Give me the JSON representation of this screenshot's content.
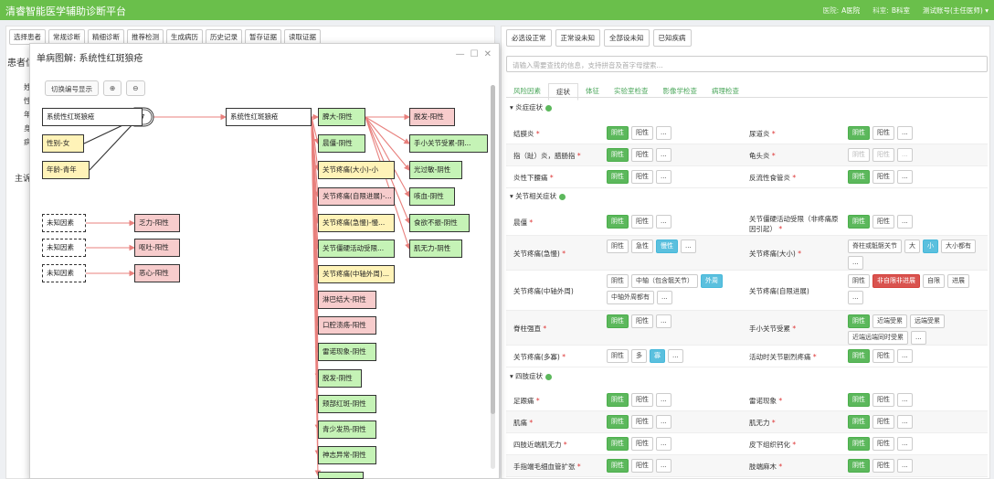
{
  "app": {
    "title": "清睿智能医学辅助诊断平台",
    "hospital_label": "医院:",
    "hospital": "A医院",
    "dept_label": "科室:",
    "dept": "B科室",
    "account": "测试账号(主任医师)",
    "account_caret": "▾"
  },
  "left": {
    "nav": [
      "选择患者",
      "常规诊断",
      "精细诊断",
      "推荐检测",
      "生成病历",
      "历史记录",
      "暂存证据",
      "读取证据"
    ],
    "label_patient": "患者信",
    "label_main": "主诉",
    "side_chars": [
      "姓",
      "性",
      "年",
      "身",
      "病"
    ]
  },
  "modal": {
    "title": "单病图解: 系统性红斑狼疮",
    "minimize": "—",
    "maximize": "☐",
    "close": "✕",
    "toggle_label": "切换编号显示",
    "zoom_in": "⊕",
    "zoom_out": "⊖",
    "gate_number": "7",
    "nodes": [
      {
        "id": "src",
        "text": "系统性红斑狼疮",
        "style": "white"
      },
      {
        "id": "sex",
        "text": "性别-女",
        "style": "yellow"
      },
      {
        "id": "age",
        "text": "年龄-青年",
        "style": "yellow"
      },
      {
        "id": "dis",
        "text": "系统性红斑狼疮",
        "style": "white"
      },
      {
        "id": "u1",
        "text": "未知因素",
        "style": "dashed"
      },
      {
        "id": "u2",
        "text": "未知因素",
        "style": "dashed"
      },
      {
        "id": "u3",
        "text": "未知因素",
        "style": "dashed"
      },
      {
        "id": "e1",
        "text": "乏力-阳性",
        "style": "pink"
      },
      {
        "id": "e2",
        "text": "呕吐-阳性",
        "style": "pink"
      },
      {
        "id": "e3",
        "text": "恶心-阳性",
        "style": "pink"
      },
      {
        "id": "c1",
        "text": "脾大-阴性",
        "style": "green"
      },
      {
        "id": "c2",
        "text": "晨僵-阴性",
        "style": "green"
      },
      {
        "id": "c3",
        "text": "关节疼痛(大小)-小",
        "style": "yellow"
      },
      {
        "id": "c4",
        "text": "关节疼痛(自限进展)-...",
        "style": "pink"
      },
      {
        "id": "c5",
        "text": "关节疼痛(急慢)-慢...",
        "style": "yellow"
      },
      {
        "id": "c6",
        "text": "关节僵硬活动受限...",
        "style": "green"
      },
      {
        "id": "c7",
        "text": "关节疼痛(中轴外周)...",
        "style": "yellow"
      },
      {
        "id": "c8",
        "text": "淋巴结大-阳性",
        "style": "pink"
      },
      {
        "id": "c9",
        "text": "口腔溃疡-阳性",
        "style": "pink"
      },
      {
        "id": "c10",
        "text": "雷诺现象-阴性",
        "style": "green"
      },
      {
        "id": "c11",
        "text": "脱发-阴性",
        "style": "green"
      },
      {
        "id": "c12",
        "text": "颊部红斑-阴性",
        "style": "green"
      },
      {
        "id": "c13",
        "text": "青少发热-阴性",
        "style": "green"
      },
      {
        "id": "c14",
        "text": "神志异常-阴性",
        "style": "green"
      },
      {
        "id": "c15",
        "text": "",
        "style": "green"
      },
      {
        "id": "d1",
        "text": "脱发-阳性",
        "style": "pink"
      },
      {
        "id": "d2",
        "text": "手小关节受累-阴...",
        "style": "green"
      },
      {
        "id": "d3",
        "text": "光过敏-阴性",
        "style": "green"
      },
      {
        "id": "d4",
        "text": "咳血-阴性",
        "style": "green"
      },
      {
        "id": "d5",
        "text": "食欲不振-阴性",
        "style": "green"
      },
      {
        "id": "d6",
        "text": "肌无力-阴性",
        "style": "green"
      }
    ]
  },
  "right": {
    "top_buttons": [
      "必选设正常",
      "正常设未知",
      "全部设未知",
      "已知疾病"
    ],
    "search_placeholder": "请输入需要查找的信息，支持拼音及首字母搜索...",
    "tabs": [
      "风险因素",
      "症状",
      "体征",
      "实验室检查",
      "影像学检查",
      "病理检查"
    ],
    "active_tab": 1,
    "sections": [
      "炎症症状",
      "关节相关症状",
      "四肢症状"
    ],
    "section_caret": "▾",
    "rows": [
      {
        "left": {
          "label": "结膜炎",
          "req": true,
          "opts": [
            {
              "t": "阴性",
              "s": "g"
            },
            {
              "t": "阳性"
            },
            {
              "t": "..."
            }
          ]
        },
        "right": {
          "label": "尿道炎",
          "req": true,
          "opts": [
            {
              "t": "阴性",
              "s": "g"
            },
            {
              "t": "阳性"
            },
            {
              "t": "..."
            }
          ]
        }
      },
      {
        "left": {
          "label": "指（趾）炎，腊肠指",
          "req": true,
          "opts": [
            {
              "t": "阴性",
              "s": "g"
            },
            {
              "t": "阳性"
            },
            {
              "t": "..."
            }
          ]
        },
        "right": {
          "label": "龟头炎",
          "req": true,
          "opts": [
            {
              "t": "阴性",
              "s": "d"
            },
            {
              "t": "阳性",
              "s": "d"
            },
            {
              "t": "...",
              "s": "d"
            }
          ]
        }
      },
      {
        "left": {
          "label": "炎性下腰痛",
          "req": true,
          "opts": [
            {
              "t": "阴性",
              "s": "g"
            },
            {
              "t": "阳性"
            },
            {
              "t": "..."
            }
          ]
        },
        "right": {
          "label": "反流性食管炎",
          "req": true,
          "opts": [
            {
              "t": "阴性",
              "s": "g"
            },
            {
              "t": "阳性"
            },
            {
              "t": "..."
            }
          ]
        }
      },
      {
        "left": {
          "label": "晨僵",
          "req": true,
          "opts": [
            {
              "t": "阴性",
              "s": "g"
            },
            {
              "t": "阳性"
            },
            {
              "t": "..."
            }
          ]
        },
        "right": {
          "label": "关节僵硬活动受限（非疼痛原因引起）",
          "req": true,
          "opts": [
            {
              "t": "阴性",
              "s": "g"
            },
            {
              "t": "阳性"
            },
            {
              "t": "..."
            }
          ]
        }
      },
      {
        "left": {
          "label": "关节疼痛(急慢)",
          "req": true,
          "opts": [
            {
              "t": "阴性"
            },
            {
              "t": "急性"
            },
            {
              "t": "慢性",
              "s": "b"
            },
            {
              "t": "..."
            }
          ]
        },
        "right": {
          "label": "关节疼痛(大小)",
          "req": true,
          "opts": [
            {
              "t": "脊柱或骶髂关节"
            },
            {
              "t": "大"
            },
            {
              "t": "小",
              "s": "b"
            },
            {
              "t": "大小都有"
            },
            {
              "t": "..."
            }
          ]
        }
      },
      {
        "left": {
          "label": "关节疼痛(中轴外周)",
          "req": false,
          "opts": [
            {
              "t": "阴性"
            },
            {
              "t": "中轴（包含髋关节）"
            },
            {
              "t": "外周",
              "s": "b"
            },
            {
              "t": "中轴外周都有"
            },
            {
              "t": "..."
            }
          ]
        },
        "right": {
          "label": "关节疼痛(自限进展)",
          "req": false,
          "opts": [
            {
              "t": "阴性"
            },
            {
              "t": "非自限非进展",
              "s": "r"
            },
            {
              "t": "自限"
            },
            {
              "t": "进展"
            },
            {
              "t": "..."
            }
          ]
        }
      },
      {
        "left": {
          "label": "脊柱强直",
          "req": true,
          "opts": [
            {
              "t": "阴性",
              "s": "g"
            },
            {
              "t": "阳性"
            },
            {
              "t": "..."
            }
          ]
        },
        "right": {
          "label": "手小关节受累",
          "req": true,
          "opts": [
            {
              "t": "阴性",
              "s": "g"
            },
            {
              "t": "近端受累"
            },
            {
              "t": "远端受累"
            },
            {
              "t": "近端远端同时受累"
            },
            {
              "t": "..."
            }
          ]
        }
      },
      {
        "left": {
          "label": "关节疼痛(多寡)",
          "req": true,
          "opts": [
            {
              "t": "阴性"
            },
            {
              "t": "多"
            },
            {
              "t": "寡",
              "s": "b"
            },
            {
              "t": "..."
            }
          ]
        },
        "right": {
          "label": "活动时关节剧烈疼痛",
          "req": true,
          "opts": [
            {
              "t": "阴性",
              "s": "g"
            },
            {
              "t": "阳性"
            },
            {
              "t": "..."
            }
          ]
        }
      },
      {
        "left": {
          "label": "足跟痛",
          "req": true,
          "opts": [
            {
              "t": "阴性",
              "s": "g"
            },
            {
              "t": "阳性"
            },
            {
              "t": "..."
            }
          ]
        },
        "right": {
          "label": "雷诺现象",
          "req": true,
          "opts": [
            {
              "t": "阴性",
              "s": "g"
            },
            {
              "t": "阳性"
            },
            {
              "t": "..."
            }
          ]
        }
      },
      {
        "left": {
          "label": "肌痛",
          "req": true,
          "opts": [
            {
              "t": "阴性",
              "s": "g"
            },
            {
              "t": "阳性"
            },
            {
              "t": "..."
            }
          ]
        },
        "right": {
          "label": "肌无力",
          "req": true,
          "opts": [
            {
              "t": "阴性",
              "s": "g"
            },
            {
              "t": "阳性"
            },
            {
              "t": "..."
            }
          ]
        }
      },
      {
        "left": {
          "label": "四肢近端肌无力",
          "req": true,
          "opts": [
            {
              "t": "阴性",
              "s": "g"
            },
            {
              "t": "阳性"
            },
            {
              "t": "..."
            }
          ]
        },
        "right": {
          "label": "皮下组织钙化",
          "req": true,
          "opts": [
            {
              "t": "阴性",
              "s": "g"
            },
            {
              "t": "阳性"
            },
            {
              "t": "..."
            }
          ]
        }
      },
      {
        "left": {
          "label": "手指端毛细血管扩张",
          "req": true,
          "opts": [
            {
              "t": "阴性",
              "s": "g"
            },
            {
              "t": "阳性"
            },
            {
              "t": "..."
            }
          ]
        },
        "right": {
          "label": "肢端麻木",
          "req": true,
          "opts": [
            {
              "t": "阴性",
              "s": "g"
            },
            {
              "t": "阳性"
            },
            {
              "t": "..."
            }
          ]
        }
      }
    ]
  }
}
